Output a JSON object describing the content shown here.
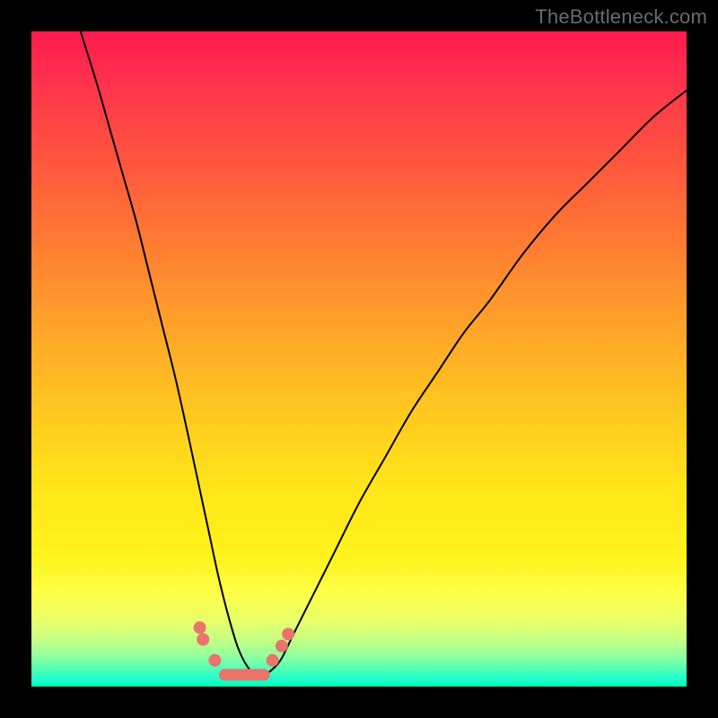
{
  "watermark": "TheBottleneck.com",
  "colors": {
    "frame": "#000000",
    "curve": "#000000",
    "marker": "#e8746b",
    "gradient_top": "#ff1a4d",
    "gradient_bottom": "#00ffa8"
  },
  "chart_data": {
    "type": "line",
    "title": "",
    "xlabel": "",
    "ylabel": "",
    "xlim": [
      0,
      100
    ],
    "ylim": [
      0,
      100
    ],
    "series": [
      {
        "name": "bottleneck-curve",
        "x": [
          7.5,
          10,
          12,
          14,
          16,
          18,
          20,
          22,
          24,
          25.5,
          27,
          28.5,
          30,
          31.5,
          33,
          34.5,
          36,
          38,
          40,
          43,
          46,
          50,
          54,
          58,
          62,
          66,
          70,
          75,
          80,
          85,
          90,
          95,
          100
        ],
        "values": [
          100,
          92,
          85,
          78,
          71,
          63,
          55,
          47,
          38,
          31,
          24,
          17,
          11,
          6,
          3,
          1.5,
          2,
          4,
          8,
          14,
          20,
          28,
          35,
          42,
          48,
          54,
          59,
          66,
          72,
          77,
          82,
          87,
          91
        ]
      }
    ],
    "markers": [
      {
        "x": 25.7,
        "y": 9.0
      },
      {
        "x": 26.2,
        "y": 7.2
      },
      {
        "x": 28.0,
        "y": 4.0
      },
      {
        "x": 36.8,
        "y": 4.0
      },
      {
        "x": 38.2,
        "y": 6.2
      },
      {
        "x": 39.2,
        "y": 8.0
      }
    ],
    "trough_segment": {
      "x0": 29.5,
      "x1": 35.5,
      "y": 1.8
    }
  }
}
